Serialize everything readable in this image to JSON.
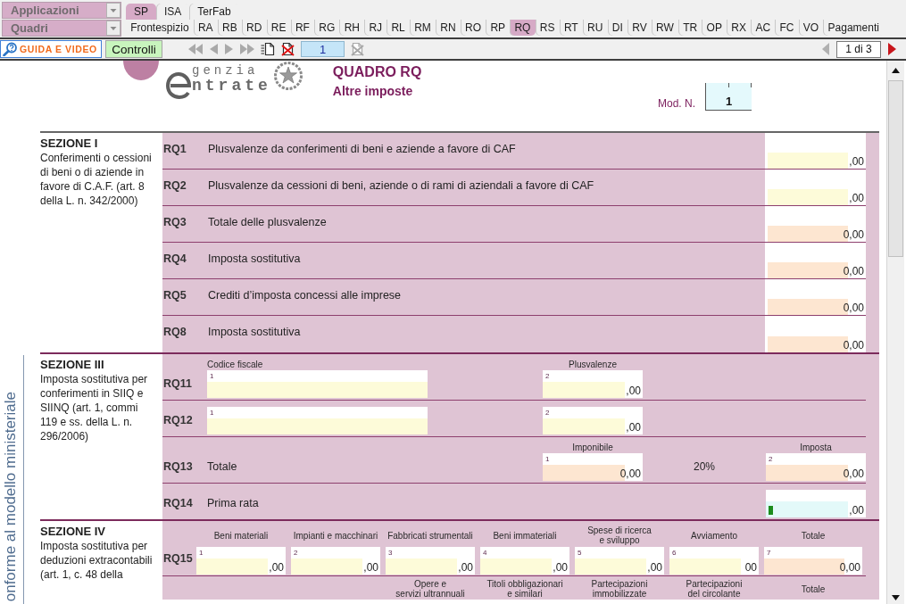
{
  "menus": [
    {
      "label": "Applicazioni",
      "tabs": [
        {
          "label": "SP",
          "selected": true
        },
        {
          "label": "ISA",
          "selected": false
        },
        {
          "label": "TerFab",
          "selected": false
        }
      ]
    },
    {
      "label": "Quadri",
      "tabs": [
        {
          "label": "Frontespizio",
          "selected": false
        },
        {
          "label": "RA",
          "selected": false
        },
        {
          "label": "RB",
          "selected": false
        },
        {
          "label": "RD",
          "selected": false
        },
        {
          "label": "RE",
          "selected": false
        },
        {
          "label": "RF",
          "selected": false
        },
        {
          "label": "RG",
          "selected": false
        },
        {
          "label": "RH",
          "selected": false
        },
        {
          "label": "RJ",
          "selected": false
        },
        {
          "label": "RL",
          "selected": false
        },
        {
          "label": "RM",
          "selected": false
        },
        {
          "label": "RN",
          "selected": false
        },
        {
          "label": "RO",
          "selected": false
        },
        {
          "label": "RP",
          "selected": false
        },
        {
          "label": "RQ",
          "selected": true
        },
        {
          "label": "RS",
          "selected": false
        },
        {
          "label": "RT",
          "selected": false
        },
        {
          "label": "RU",
          "selected": false
        },
        {
          "label": "DI",
          "selected": false
        },
        {
          "label": "RV",
          "selected": false
        },
        {
          "label": "RW",
          "selected": false
        },
        {
          "label": "TR",
          "selected": false
        },
        {
          "label": "OP",
          "selected": false
        },
        {
          "label": "RX",
          "selected": false
        },
        {
          "label": "AC",
          "selected": false
        },
        {
          "label": "FC",
          "selected": false
        },
        {
          "label": "VO",
          "selected": false
        },
        {
          "label": "Pagamenti",
          "selected": false
        }
      ]
    }
  ],
  "toolbar": {
    "guide_button": "GUIDA E VIDEO",
    "check_button": "Controlli",
    "record_tools": [
      {
        "kind": "first",
        "disabled": true
      },
      {
        "kind": "previous",
        "disabled": true
      },
      {
        "kind": "next",
        "disabled": true
      },
      {
        "kind": "last",
        "disabled": true
      },
      {
        "kind": "new",
        "disabled": false
      },
      {
        "kind": "delete",
        "disabled": false
      },
      {
        "kind": "number",
        "value": "1"
      },
      {
        "kind": "delete",
        "disabled": true
      }
    ],
    "pager": [
      {
        "kind": "previous",
        "disabled": true
      },
      {
        "kind": "indicator",
        "label": "1 di 3"
      },
      {
        "kind": "next",
        "disabled": false
      }
    ]
  },
  "side_note": "onforme al modello ministeriale",
  "header": {
    "logo_lines": [
      "genzia",
      "ntrate"
    ],
    "title": "QUADRO RQ",
    "subtitle": "Altre imposte",
    "module_label": "Mod. N.",
    "module_number": "1"
  },
  "sections": [
    {
      "kind": "lines",
      "title": "SEZIONE I",
      "description": "Conferimenti o cessioni di beni o di aziende in favore di C.A.F. (art. 8 della L. n. 342/2000)",
      "rows": [
        {
          "code": "RQ1",
          "label": "Plusvalenze da conferimenti di beni e aziende a favore di CAF",
          "field": {
            "kind": "input",
            "value": ",00"
          }
        },
        {
          "code": "RQ2",
          "label": "Plusvalenze da cessioni di beni, aziende o di rami di aziendali a favore di CAF",
          "field": {
            "kind": "input",
            "value": ",00"
          }
        },
        {
          "code": "RQ3",
          "label": "Totale delle plusvalenze",
          "field": {
            "kind": "computed",
            "value": "0,00"
          }
        },
        {
          "code": "RQ4",
          "label": "Imposta sostitutiva",
          "field": {
            "kind": "computed",
            "value": "0,00"
          }
        },
        {
          "code": "RQ5",
          "label": "Crediti d’imposta concessi alle imprese",
          "field": {
            "kind": "computed",
            "value": "0,00"
          }
        },
        {
          "code": "RQ8",
          "label": "Imposta sostitutiva",
          "field": {
            "kind": "computed",
            "value": "0,00"
          }
        }
      ]
    },
    {
      "kind": "grid",
      "title": "SEZIONE III",
      "description": "Imposta sostitutiva per conferimenti in SIIQ e SIINQ (art. 1, commi 119 e ss. della L. n. 296/2006)",
      "rows": [
        {
          "code": "RQ11",
          "fields": [
            {
              "header": "Codice fiscale",
              "number": "1",
              "kind": "input"
            },
            {
              "header": "Plusvalenze",
              "number": "2",
              "kind": "input",
              "value": ",00"
            }
          ]
        },
        {
          "code": "RQ12",
          "fields": [
            {
              "number": "1",
              "kind": "input"
            },
            {
              "number": "2",
              "kind": "input",
              "value": ",00"
            }
          ]
        },
        {
          "code": "RQ13",
          "label": "Totale",
          "rate": "20%",
          "fields": [
            {
              "header": "Imponibile",
              "number": "1",
              "kind": "computed",
              "value": "0,00"
            },
            {
              "header": "Imposta",
              "number": "2",
              "kind": "computed",
              "value": "0,00"
            }
          ]
        },
        {
          "code": "RQ14",
          "label": "Prima rata",
          "fields": [
            {
              "kind": "active",
              "value": ",00"
            }
          ]
        }
      ]
    },
    {
      "kind": "columns",
      "title": "SEZIONE IV",
      "description": "Imposta sostitutiva per deduzioni extracontabili (art. 1, c. 48 della",
      "rows": [
        {
          "code": "RQ15",
          "fields": [
            {
              "header": "Beni materiali",
              "number": "1",
              "kind": "input",
              "value": ",00"
            },
            {
              "header": "Impianti e macchinari",
              "number": "2",
              "kind": "input",
              "value": ",00"
            },
            {
              "header": "Fabbricati strumentali",
              "number": "3",
              "kind": "input",
              "value": ",00"
            },
            {
              "header": "Beni immateriali",
              "number": "4",
              "kind": "input",
              "value": ",00"
            },
            {
              "header": "Spese di ricerca e sviluppo",
              "number": "5",
              "kind": "input",
              "value": ",00"
            },
            {
              "header": "Avviamento",
              "number": "6",
              "kind": "input",
              "value": "00"
            },
            {
              "header": "Totale",
              "number": "7",
              "kind": "computed",
              "value": "0,00"
            }
          ]
        },
        {
          "headers": [
            "Opere e servizi ultrannuali",
            "Titoli obbligazionari e similari",
            "Partecipazioni immobilizzate",
            "Partecipazioni del circolante",
            "Totale"
          ]
        }
      ]
    }
  ]
}
